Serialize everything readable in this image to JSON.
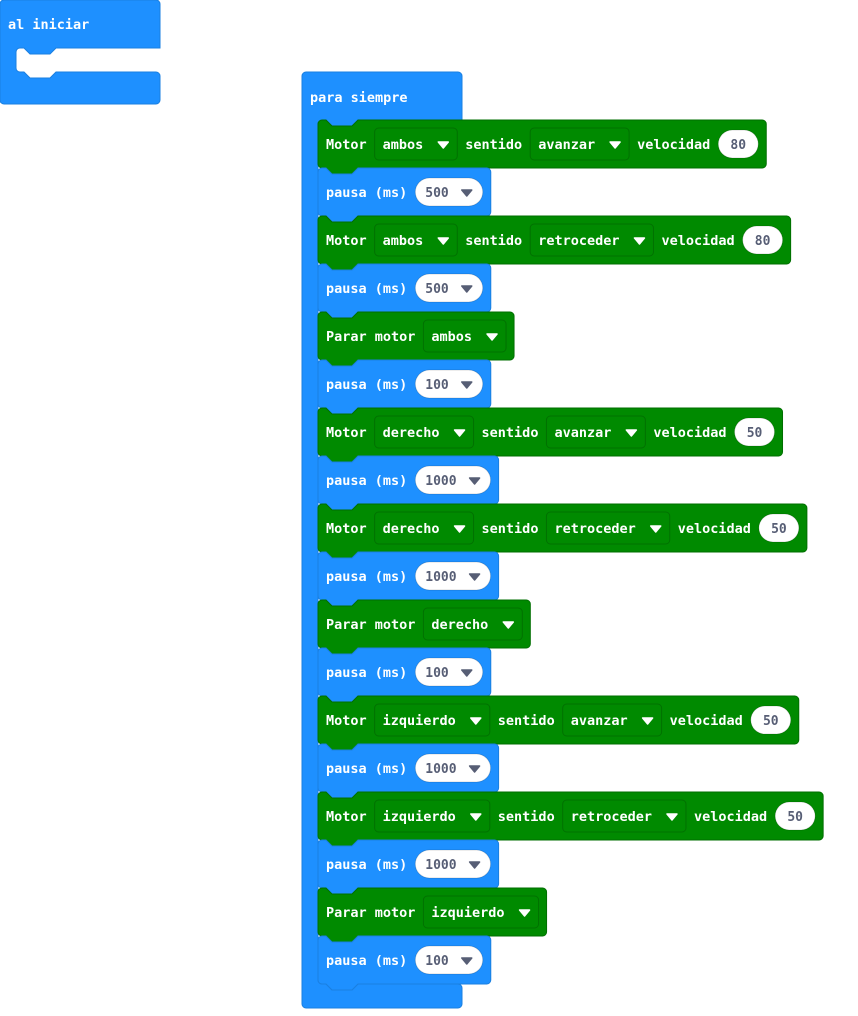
{
  "colors": {
    "basic": "#1e90ff",
    "basic_stroke": "#1a7fe0",
    "motor": "#008a00",
    "motor_stroke": "#006f00",
    "field_text": "#575e75",
    "white": "#ffffff"
  },
  "icons": {
    "dropdown": "caret-down-icon"
  },
  "on_start": {
    "label": "al iniciar"
  },
  "forever": {
    "label": "para siempre",
    "blocks": [
      {
        "type": "motor",
        "motor": "ambos",
        "sentido_label": "sentido",
        "sentido": "avanzar",
        "velocidad_label": "velocidad",
        "velocidad": "80"
      },
      {
        "type": "pause",
        "value": "500"
      },
      {
        "type": "motor",
        "motor": "ambos",
        "sentido_label": "sentido",
        "sentido": "retroceder",
        "velocidad_label": "velocidad",
        "velocidad": "80"
      },
      {
        "type": "pause",
        "value": "500"
      },
      {
        "type": "stop",
        "motor": "ambos"
      },
      {
        "type": "pause",
        "value": "100"
      },
      {
        "type": "motor",
        "motor": "derecho",
        "sentido_label": "sentido",
        "sentido": "avanzar",
        "velocidad_label": "velocidad",
        "velocidad": "50"
      },
      {
        "type": "pause",
        "value": "1000"
      },
      {
        "type": "motor",
        "motor": "derecho",
        "sentido_label": "sentido",
        "sentido": "retroceder",
        "velocidad_label": "velocidad",
        "velocidad": "50"
      },
      {
        "type": "pause",
        "value": "1000"
      },
      {
        "type": "stop",
        "motor": "derecho"
      },
      {
        "type": "pause",
        "value": "100"
      },
      {
        "type": "motor",
        "motor": "izquierdo",
        "sentido_label": "sentido",
        "sentido": "avanzar",
        "velocidad_label": "velocidad",
        "velocidad": "50"
      },
      {
        "type": "pause",
        "value": "1000"
      },
      {
        "type": "motor",
        "motor": "izquierdo",
        "sentido_label": "sentido",
        "sentido": "retroceder",
        "velocidad_label": "velocidad",
        "velocidad": "50"
      },
      {
        "type": "pause",
        "value": "1000"
      },
      {
        "type": "stop",
        "motor": "izquierdo"
      },
      {
        "type": "pause",
        "value": "100"
      }
    ]
  },
  "labels": {
    "motor": "Motor",
    "pause": "pausa (ms)",
    "stop": "Parar motor"
  }
}
